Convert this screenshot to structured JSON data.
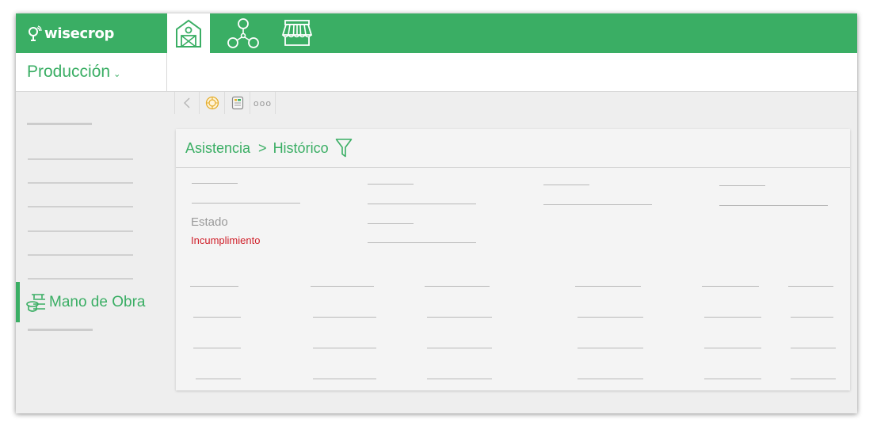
{
  "app": {
    "brand": "wisecrop"
  },
  "nav": {
    "tabs": [
      {
        "icon": "farm-house-icon",
        "active": true
      },
      {
        "icon": "network-nodes-icon",
        "active": false
      },
      {
        "icon": "market-stall-icon",
        "active": false
      }
    ]
  },
  "module": {
    "label": "Producción",
    "chevron": "⌄"
  },
  "sidebar": {
    "active_item": {
      "label": "Mano de Obra",
      "icon": "workforce-icon"
    }
  },
  "toolbar": {
    "items": [
      {
        "icon": "back-arrow-icon"
      },
      {
        "icon": "target-icon"
      },
      {
        "icon": "notes-icon"
      },
      {
        "icon": "more-options-icon",
        "glyph": "ooo"
      }
    ]
  },
  "panel": {
    "breadcrumb": {
      "first": "Asistencia",
      "separator": ">",
      "second": "Histórico"
    },
    "filter_icon": "filter-funnel-icon",
    "status": {
      "label": "Estado",
      "value": "Incumplimiento"
    }
  },
  "colors": {
    "brand_green": "#3aae64",
    "error_red": "#d0202a",
    "background": "#eeeeee",
    "panel": "#f4f4f4"
  }
}
